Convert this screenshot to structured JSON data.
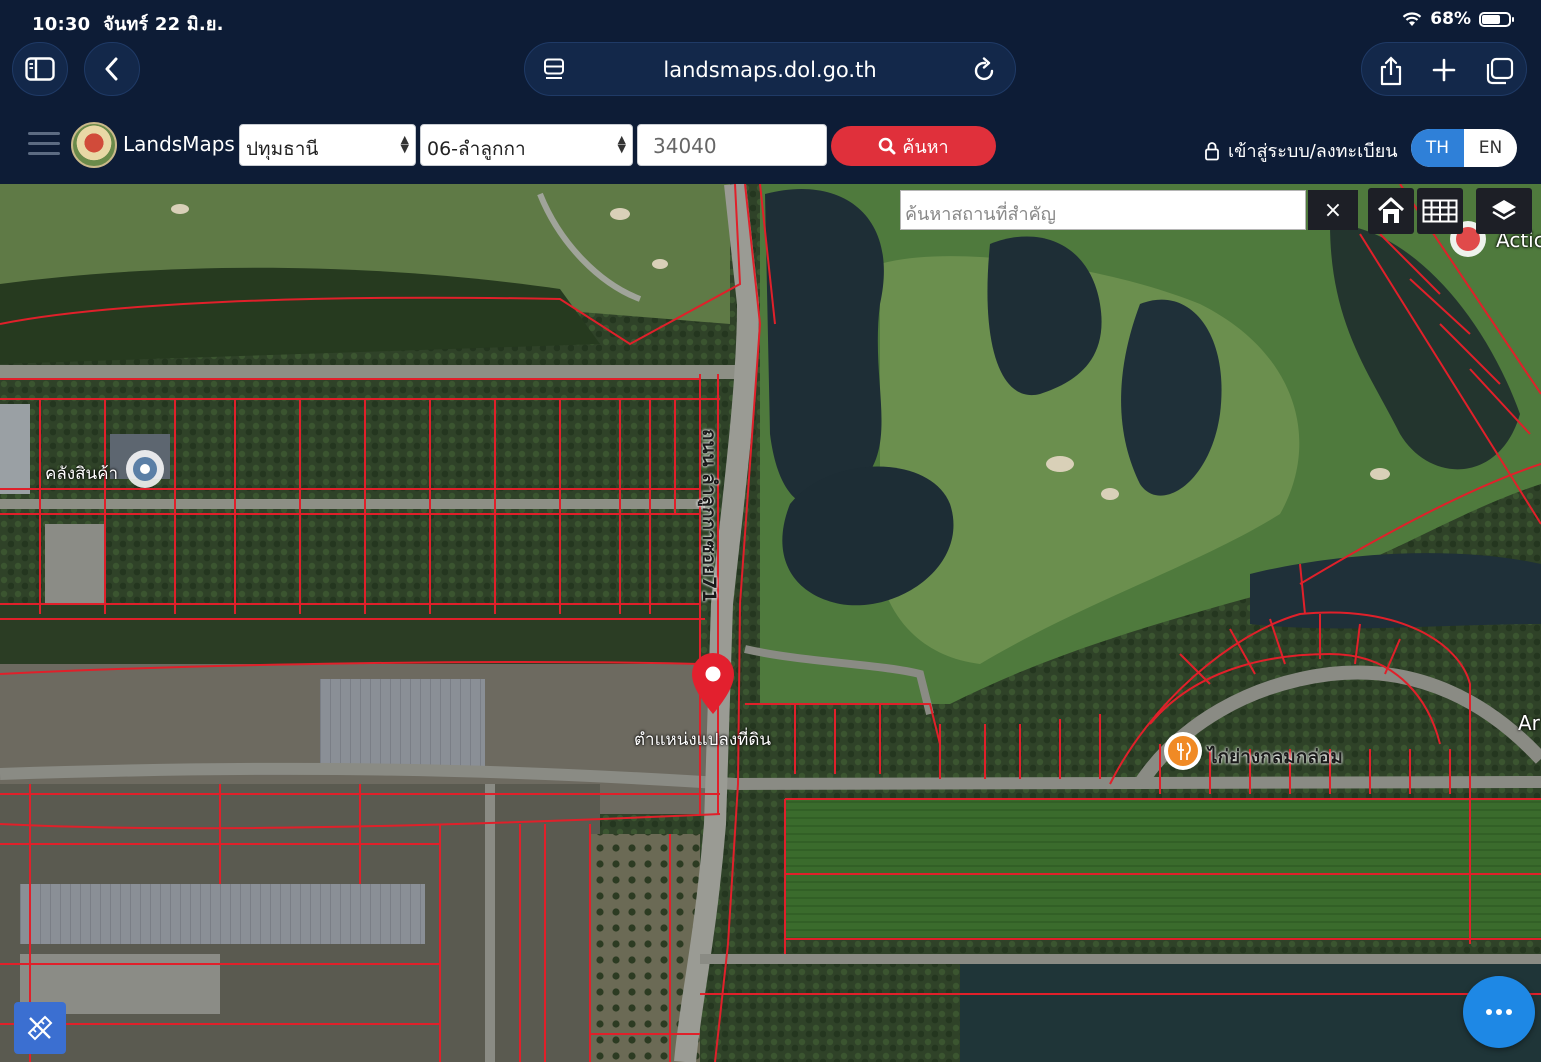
{
  "status_bar": {
    "time": "10:30",
    "date": "จันทร์ 22 มิ.ย.",
    "battery": "68%",
    "battery_level": 0.68
  },
  "browser": {
    "url": "landsmaps.dol.go.th"
  },
  "app": {
    "brand": "LandsMaps",
    "province": "ปทุมธานี",
    "district": "06-ลำลูกกา",
    "parcel_number": "34040",
    "search_label": "ค้นหา",
    "login_label": "เข้าสู่ระบบ/ลงทะเบียน",
    "lang_th": "TH",
    "lang_en": "EN"
  },
  "map": {
    "search_placeholder": "ค้นหาสถานที่สำคัญ",
    "clear_label": "×",
    "labels": {
      "warehouse": "คลังสินค้า",
      "road": "ถนน ลำลูกกาซอย71",
      "parcel_location": "ตำแหน่งแปลงที่ดิน",
      "restaurant": "ไก่ย่างกลมกล่อม",
      "edge_action": "Actic",
      "edge_ar": "Ar"
    },
    "colors": {
      "parcel_line": "#e0202a",
      "marker": "#e3202e",
      "fab": "#1e88e5"
    }
  }
}
